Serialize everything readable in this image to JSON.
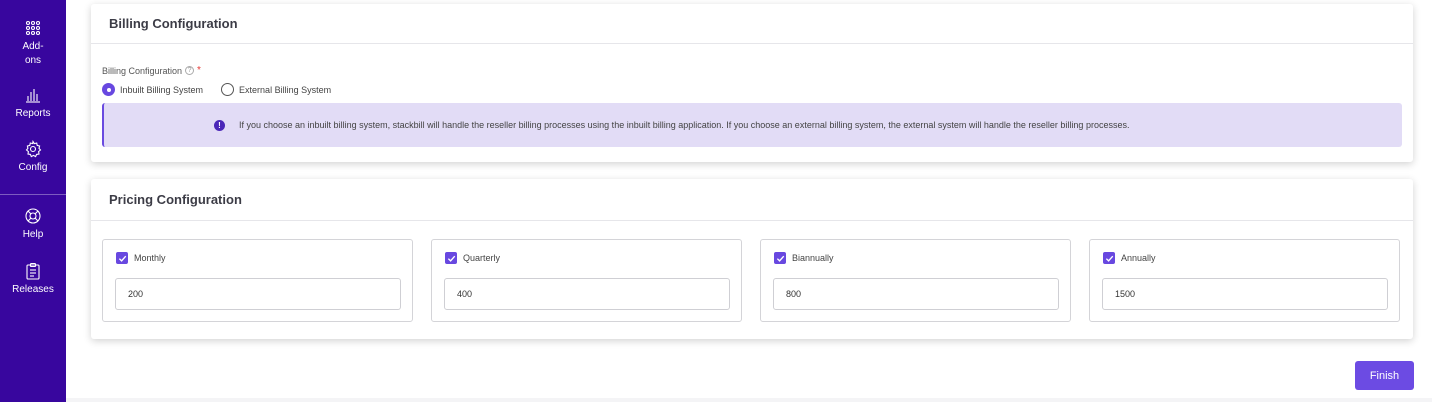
{
  "sidebar": {
    "items": [
      {
        "label": "Add-\nons",
        "icon": "grid-dots-icon"
      },
      {
        "label": "Reports",
        "icon": "bar-chart-icon"
      },
      {
        "label": "Config",
        "icon": "gear-icon"
      },
      {
        "label": "Help",
        "icon": "lifebuoy-icon"
      },
      {
        "label": "Releases",
        "icon": "clipboard-icon"
      }
    ]
  },
  "billing": {
    "title": "Billing Configuration",
    "field_label": "Billing Configuration",
    "required_mark": "*",
    "options": [
      {
        "label": "Inbuilt Billing System",
        "selected": true
      },
      {
        "label": "External Billing System",
        "selected": false
      }
    ],
    "info_text": "If you choose an inbuilt billing system, stackbill will handle the reseller billing processes using the inbuilt billing application. If you choose an external billing system, the external system will handle the reseller billing processes."
  },
  "pricing": {
    "title": "Pricing Configuration",
    "plans": [
      {
        "label": "Monthly",
        "checked": true,
        "value": "200"
      },
      {
        "label": "Quarterly",
        "checked": true,
        "value": "400"
      },
      {
        "label": "Biannually",
        "checked": true,
        "value": "800"
      },
      {
        "label": "Annually",
        "checked": true,
        "value": "1500"
      }
    ]
  },
  "actions": {
    "finish_label": "Finish"
  },
  "colors": {
    "sidebar": "#38069e",
    "accent": "#6848e0",
    "info_bg": "#e2dcf6"
  }
}
